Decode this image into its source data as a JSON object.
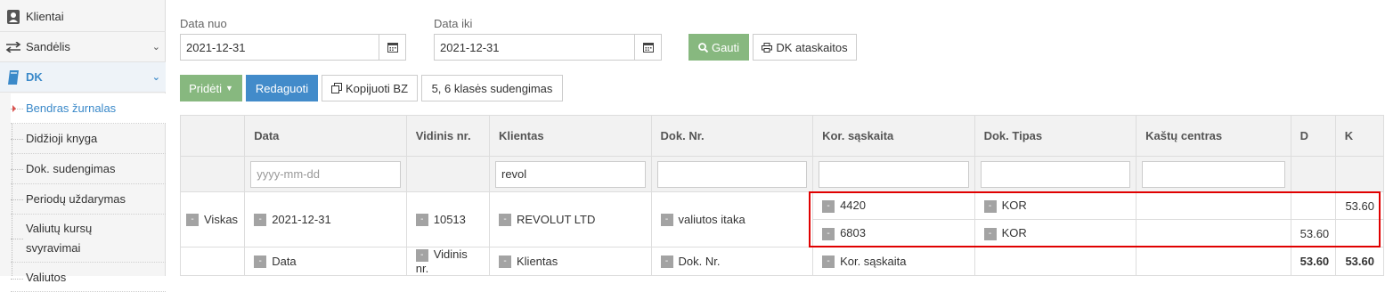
{
  "sidebar": {
    "items": [
      {
        "label": "Klientai",
        "icon": "user-icon"
      },
      {
        "label": "Sandėlis",
        "icon": "exchange-icon"
      },
      {
        "label": "DK",
        "icon": "book-icon"
      }
    ],
    "sub_items": [
      "Bendras žurnalas",
      "Didžioji knyga",
      "Dok. sudengimas",
      "Periodų uždarymas",
      "Valiutų kursų svyravimai",
      "Valiutos"
    ]
  },
  "filters": {
    "date_from_label": "Data nuo",
    "date_from_value": "2021-12-31",
    "date_to_label": "Data iki",
    "date_to_value": "2021-12-31",
    "get_label": "Gauti",
    "report_label": "DK ataskaitos"
  },
  "toolbar": {
    "add_label": "Pridėti",
    "edit_label": "Redaguoti",
    "copy_label": "Kopijuoti BZ",
    "merge_label": "5, 6 klasės sudengimas"
  },
  "table": {
    "columns": [
      "",
      "Data",
      "Vidinis nr.",
      "Klientas",
      "Dok. Nr.",
      "Kor. sąskaita",
      "Dok. Tipas",
      "Kaštų centras",
      "D",
      "K"
    ],
    "filter_row": {
      "date_placeholder": "yyyy-mm-dd",
      "client_value": "revol"
    },
    "entry": {
      "all": "Viskas",
      "date": "2021-12-31",
      "internal_no": "10513",
      "client": "REVOLUT LTD",
      "doc_no": "valiutos itaka",
      "lines": [
        {
          "account": "4420",
          "doc_type": "KOR",
          "cost_center": "",
          "debit": "",
          "credit": "53.60"
        },
        {
          "account": "6803",
          "doc_type": "KOR",
          "cost_center": "",
          "debit": "53.60",
          "credit": ""
        }
      ]
    },
    "footer": {
      "date": "Data",
      "internal_no": "Vidinis nr.",
      "client": "Klientas",
      "doc_no": "Dok. Nr.",
      "account": "Kor. sąskaita",
      "total_debit": "53.60",
      "total_credit": "53.60"
    }
  },
  "colors": {
    "green_button": "#87b87f",
    "blue_button": "#428bca",
    "active_menu": "#3a89c9",
    "highlight": "#e00000"
  }
}
